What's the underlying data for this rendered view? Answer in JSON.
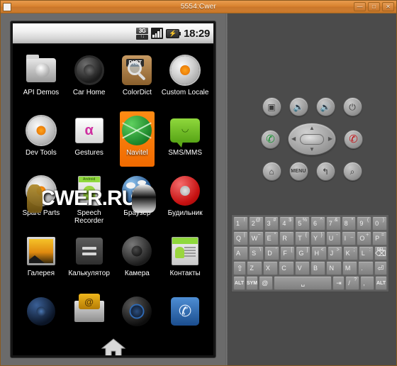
{
  "window": {
    "title": "5554:Cwer",
    "app_icon": "window-icon",
    "buttons": [
      {
        "name": "minimize",
        "glyph": "—"
      },
      {
        "name": "maximize",
        "glyph": "□"
      },
      {
        "name": "close",
        "glyph": "✕"
      }
    ]
  },
  "statusbar": {
    "network_top": "3G",
    "network_bottom": "↑↓",
    "signal_icon": "signal-bars-icon",
    "battery_icon": "battery-charging-icon",
    "battery_glyph": "⚡",
    "time": "18:29"
  },
  "apps": {
    "rows": [
      [
        {
          "label": "API Demos",
          "icon": "api-demos-icon",
          "selected": false
        },
        {
          "label": "Car Home",
          "icon": "car-home-icon",
          "selected": false
        },
        {
          "label": "ColorDict",
          "icon": "colordict-icon",
          "selected": false,
          "badge": "DICT"
        },
        {
          "label": "Custom Locale",
          "icon": "custom-locale-icon",
          "selected": false,
          "two_line": true
        }
      ],
      [
        {
          "label": "Dev Tools",
          "icon": "dev-tools-icon",
          "selected": false
        },
        {
          "label": "Gestures",
          "icon": "gestures-icon",
          "selected": false,
          "glyph": "α"
        },
        {
          "label": "Navitel",
          "icon": "navitel-icon",
          "selected": true
        },
        {
          "label": "SMS/MMS",
          "icon": "sms-mms-icon",
          "selected": false,
          "glyph": "◡"
        }
      ],
      [
        {
          "label": "Spare Parts",
          "icon": "spare-parts-icon",
          "selected": false
        },
        {
          "label": "Speech Recorder",
          "icon": "speech-recorder-icon",
          "selected": false,
          "two_line": true,
          "badge": "Android"
        },
        {
          "label": "Браузер",
          "icon": "browser-icon",
          "selected": false
        },
        {
          "label": "Будильник",
          "icon": "alarm-clock-icon",
          "selected": false
        }
      ],
      [
        {
          "label": "Галерея",
          "icon": "gallery-icon",
          "selected": false
        },
        {
          "label": "Калькулятор",
          "icon": "calculator-icon",
          "selected": false
        },
        {
          "label": "Камера",
          "icon": "camera-icon",
          "selected": false
        },
        {
          "label": "Контакты",
          "icon": "contacts-icon",
          "selected": false
        }
      ],
      [
        {
          "label": "",
          "icon": "music-icon",
          "selected": false
        },
        {
          "label": "",
          "icon": "email-icon",
          "selected": false,
          "glyph": "@"
        },
        {
          "label": "",
          "icon": "compass-icon",
          "selected": false
        },
        {
          "label": "",
          "icon": "dialer-icon",
          "selected": false,
          "glyph": "✆"
        }
      ]
    ],
    "home_button": "home-icon"
  },
  "watermark": {
    "text": "CWER.RU"
  },
  "controls": {
    "rows": [
      [
        {
          "name": "camera-button",
          "glyph": "▣",
          "style": "plain"
        },
        {
          "name": "volume-down-button",
          "glyph": "🔉",
          "style": "plain"
        },
        {
          "name": "volume-up-button",
          "glyph": "🔊",
          "style": "plain"
        },
        {
          "name": "power-button",
          "glyph": "⏻",
          "style": "plain"
        }
      ],
      [
        {
          "name": "call-button",
          "glyph": "✆",
          "style": "green"
        },
        {
          "name": "dpad",
          "glyph": "",
          "style": "dpad"
        },
        {
          "name": "end-call-button",
          "glyph": "✆",
          "style": "red"
        }
      ],
      [
        {
          "name": "home-button",
          "glyph": "⌂",
          "style": "plain"
        },
        {
          "name": "menu-button",
          "glyph": "MENU",
          "style": "menu"
        },
        {
          "name": "back-button",
          "glyph": "↰",
          "style": "plain"
        },
        {
          "name": "search-button",
          "glyph": "⌕",
          "style": "plain"
        }
      ]
    ],
    "dpad_arrows": {
      "up": "▲",
      "down": "▼",
      "left": "◀",
      "right": "▶"
    }
  },
  "keyboard": {
    "rows": [
      [
        {
          "main": "1",
          "sup": "!"
        },
        {
          "main": "2",
          "sup": "@"
        },
        {
          "main": "3",
          "sup": "#"
        },
        {
          "main": "4",
          "sup": "$"
        },
        {
          "main": "5",
          "sup": "%"
        },
        {
          "main": "6",
          "sup": "^"
        },
        {
          "main": "7",
          "sup": "&"
        },
        {
          "main": "8",
          "sup": "*"
        },
        {
          "main": "9",
          "sup": "("
        },
        {
          "main": "0",
          "sup": ")"
        }
      ],
      [
        {
          "main": "Q",
          "sup": "|"
        },
        {
          "main": "W",
          "sup": "~"
        },
        {
          "main": "E",
          "sup": "\""
        },
        {
          "main": "R",
          "sup": "`"
        },
        {
          "main": "T",
          "sup": "{"
        },
        {
          "main": "Y",
          "sup": "}"
        },
        {
          "main": "U",
          "sup": "-"
        },
        {
          "main": "I",
          "sup": "_"
        },
        {
          "main": "O",
          "sup": "+"
        },
        {
          "main": "P",
          "sup": "="
        }
      ],
      [
        {
          "main": "A",
          "sup": ""
        },
        {
          "main": "S",
          "sup": "\\"
        },
        {
          "main": "D",
          "sup": "'"
        },
        {
          "main": "F",
          "sup": "["
        },
        {
          "main": "G",
          "sup": "]"
        },
        {
          "main": "H",
          "sup": "<"
        },
        {
          "main": "J",
          "sup": ">"
        },
        {
          "main": "K",
          "sup": ";"
        },
        {
          "main": "L",
          "sup": ":"
        },
        {
          "main": "⌫",
          "sup": "",
          "label": "DEL",
          "key": "delete-key"
        }
      ],
      [
        {
          "main": "⇧",
          "sup": "",
          "key": "shift-key"
        },
        {
          "main": "Z",
          "sup": ""
        },
        {
          "main": "X",
          "sup": ""
        },
        {
          "main": "C",
          "sup": ""
        },
        {
          "main": "V",
          "sup": ""
        },
        {
          "main": "B",
          "sup": ""
        },
        {
          "main": "N",
          "sup": ""
        },
        {
          "main": "M",
          "sup": ""
        },
        {
          "main": ".",
          "sup": ""
        },
        {
          "main": "⏎",
          "sup": "",
          "key": "enter-key"
        }
      ],
      [
        {
          "main": "ALT",
          "sup": "",
          "key": "alt-left-key",
          "small": true
        },
        {
          "main": "SYM",
          "sup": "",
          "key": "sym-key",
          "small": true
        },
        {
          "main": "@",
          "sup": "",
          "key": "at-key"
        },
        {
          "main": "␣",
          "sup": "",
          "key": "space-key",
          "wide": "space"
        },
        {
          "main": "⇥",
          "sup": "",
          "key": "tab-key"
        },
        {
          "main": "/",
          "sup": "?",
          "key": "slash-key"
        },
        {
          "main": ",",
          "sup": "",
          "key": "comma-key"
        },
        {
          "main": "ALT",
          "sup": "",
          "key": "alt-right-key",
          "small": true
        }
      ]
    ]
  }
}
